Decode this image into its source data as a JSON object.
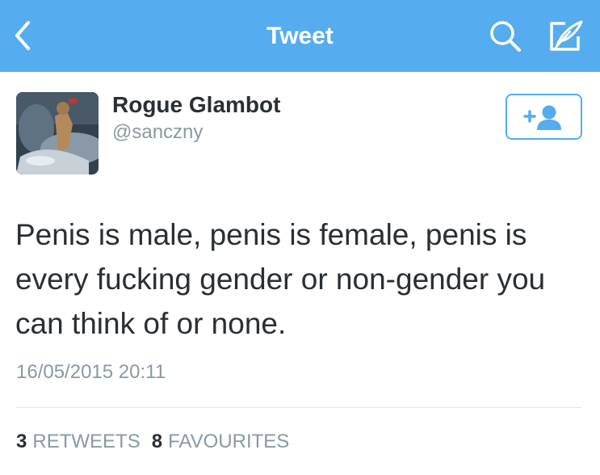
{
  "navbar": {
    "title": "Tweet",
    "background_color": "#55acee",
    "icons": {
      "back": "chevron-left-icon",
      "search": "search-icon",
      "compose": "compose-icon"
    }
  },
  "tweet": {
    "author": {
      "display_name": "Rogue Glambot",
      "handle": "@sanczny"
    },
    "follow_button": {
      "icon": "add-user-icon",
      "label": "+"
    },
    "text": "Penis is male, penis is female, penis is every fucking gender or non-gender you can think of or none.",
    "timestamp": "16/05/2015 20:11",
    "stats": {
      "retweets": {
        "count": "3",
        "label": "RETWEETS"
      },
      "favourites": {
        "count": "8",
        "label": "FAVOURITES"
      }
    }
  },
  "colors": {
    "accent": "#55acee",
    "text": "#292f33",
    "muted": "#8899a6",
    "divider": "#e1e8ed"
  }
}
